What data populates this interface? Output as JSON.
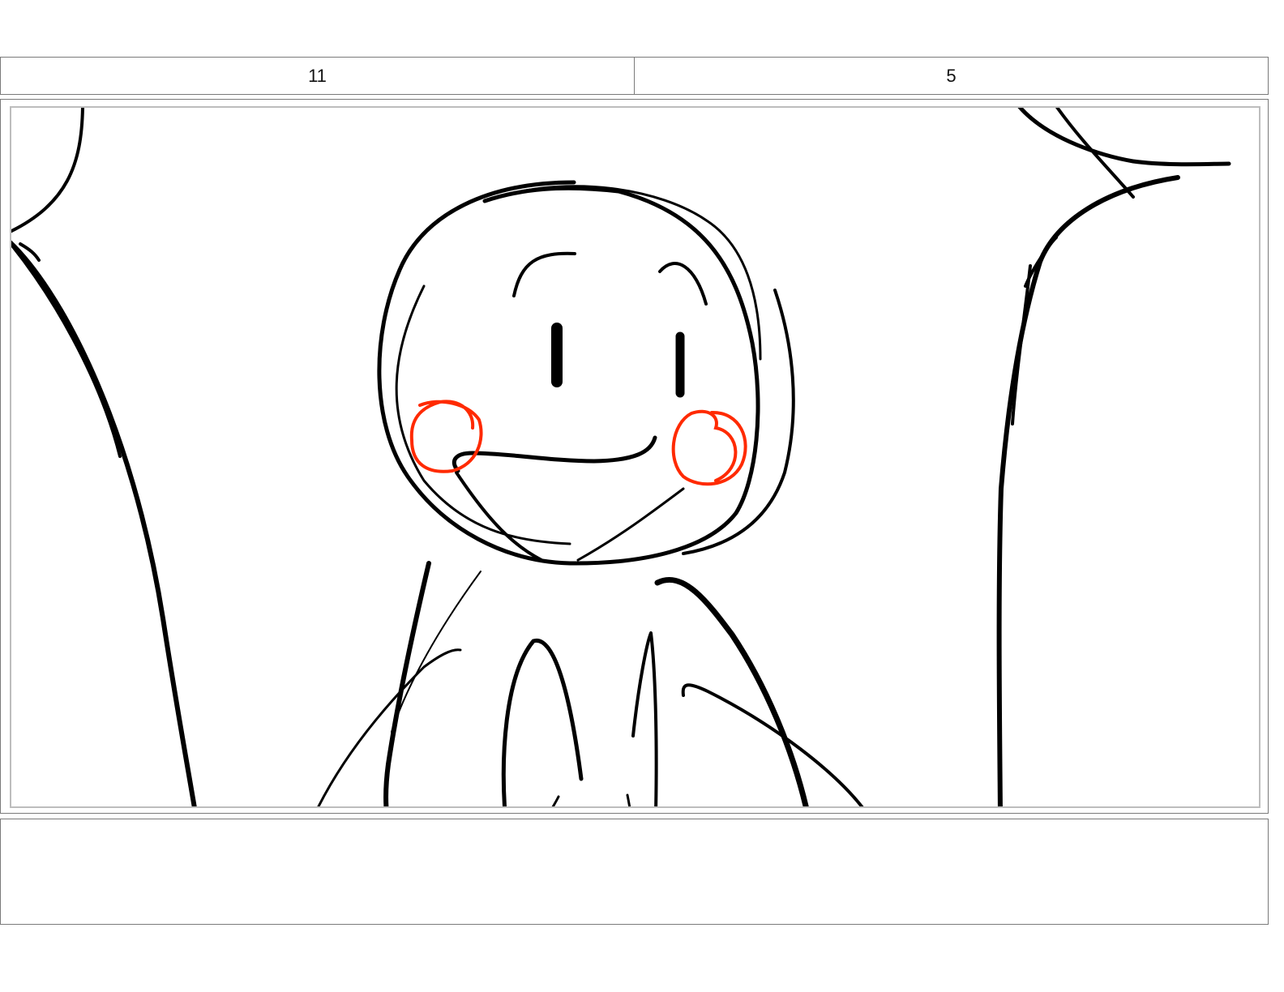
{
  "header": {
    "scene_number": "11",
    "panel_number": "5"
  },
  "panel": {
    "sketch_color": "#000000",
    "blush_color": "#ff2a00"
  },
  "notes": {
    "text": ""
  }
}
